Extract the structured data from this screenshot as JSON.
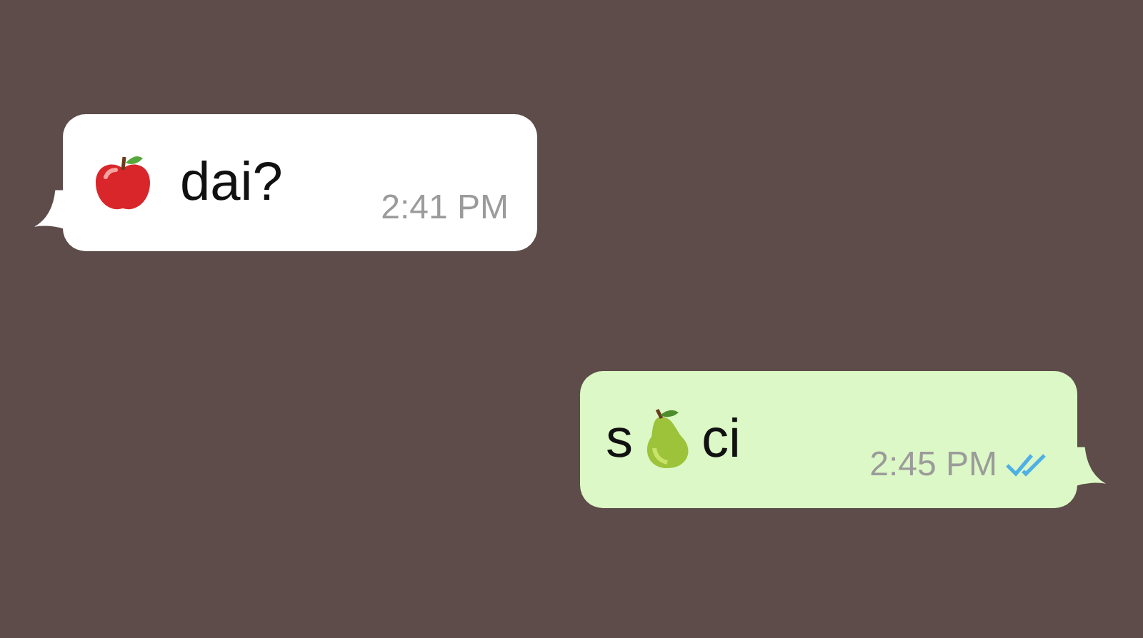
{
  "messages": [
    {
      "kind": "incoming",
      "text_after": "dai?",
      "time": "2:41 PM"
    },
    {
      "kind": "outgoing",
      "text_before": "s",
      "text_after": "ci",
      "time": "2:45 PM",
      "read": true
    }
  ]
}
